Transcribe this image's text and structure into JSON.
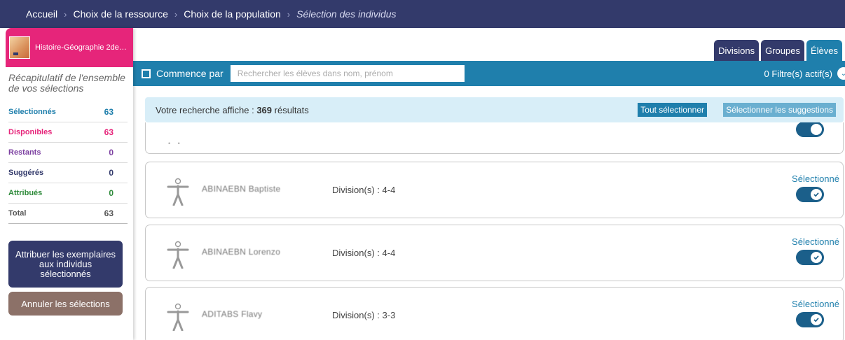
{
  "breadcrumb": {
    "items": [
      "Accueil",
      "Choix de la ressource",
      "Choix de la population"
    ],
    "current": "Sélection des individus"
  },
  "sidebar": {
    "resource_title": "Histoire-Géographie 2de…",
    "recap": "Récapitulatif de l'ensemble de vos sélections",
    "stats": [
      {
        "label": "Sélectionnés",
        "value": "63",
        "color": "#1f7fac"
      },
      {
        "label": "Disponibles",
        "value": "63",
        "color": "#e6257a"
      },
      {
        "label": "Restants",
        "value": "0",
        "color": "#7b3fa0"
      },
      {
        "label": "Suggérés",
        "value": "0",
        "color": "#333a6b"
      },
      {
        "label": "Attribués",
        "value": "0",
        "color": "#2e8a3a"
      },
      {
        "label": "Total",
        "value": "63",
        "color": "#555555"
      }
    ],
    "assign_button": "Attribuer les exemplaires aux individus sélectionnés",
    "cancel_button": "Annuler les sélections"
  },
  "tabs": [
    {
      "label": "Divisions",
      "active": false
    },
    {
      "label": "Groupes",
      "active": false
    },
    {
      "label": "Élèves",
      "active": true
    }
  ],
  "filter": {
    "checkbox_label": "Commence par",
    "search_placeholder": "Rechercher les élèves dans nom, prénom",
    "active_filters": "0 Filtre(s) actif(s)"
  },
  "results": {
    "prefix": "Votre recherche affiche :",
    "count": "369",
    "suffix": "résultats",
    "select_all": "Tout sélectionner",
    "select_suggestions": "Sélectionner les suggestions"
  },
  "students": [
    {
      "name": "ABINAEBN Baptiste",
      "division": "Division(s) : 4-4",
      "status": "Sélectionné"
    },
    {
      "name": "ABINAEBN Lorenzo",
      "division": "Division(s) : 4-4",
      "status": "Sélectionné"
    },
    {
      "name": "ADITABS Flavy",
      "division": "Division(s) : 3-3",
      "status": "Sélectionné"
    }
  ],
  "colors": {
    "navy": "#333a6b",
    "blue": "#1f7fac",
    "pink": "#e6257a",
    "brown": "#8c7168"
  }
}
